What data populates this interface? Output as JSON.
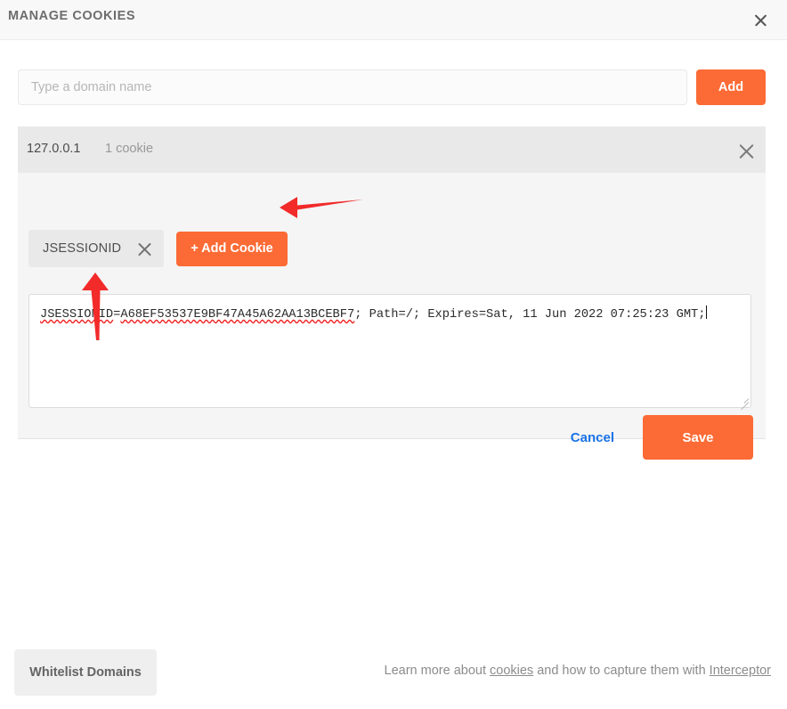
{
  "window": {
    "title": "MANAGE COOKIES",
    "close_icon": "close-icon"
  },
  "domain_entry": {
    "placeholder": "Type a domain name",
    "value": "",
    "add_label": "Add"
  },
  "domain_card": {
    "name": "127.0.0.1",
    "cookie_count": "1 cookie",
    "close_icon": "close-icon",
    "cookie_tabs": [
      {
        "label": "JSESSIONID",
        "close_icon": "close-icon"
      }
    ],
    "add_cookie_label": "+ Add Cookie",
    "cookie_value_part1": "JSESSIONID",
    "cookie_value_part2": "=",
    "cookie_value_part3": "A68EF53537E9BF47A45A62AA13BCEBF7",
    "cookie_value_part4": "; Path=/; Expires=Sat, 11 Jun 2022 07:25:23 GMT;",
    "cookie_value_full": "JSESSIONID=A68EF53537E9BF47A45A62AA13BCEBF7; Path=/; Expires=Sat, 11 Jun 2022 07:25:23 GMT;",
    "cancel_label": "Cancel",
    "save_label": "Save"
  },
  "footer": {
    "whitelist_label": "Whitelist Domains",
    "note_prefix": "Learn more about ",
    "link_cookies": "cookies",
    "note_middle": " and how to capture them with ",
    "link_interceptor": "Interceptor"
  },
  "annotations": {
    "arrow_color": "#f22a2a",
    "arrow_left_name": "arrow-pointing-to-add-cookie",
    "arrow_up_name": "arrow-pointing-to-cookie-name"
  },
  "colors": {
    "accent_orange": "#fc6b35",
    "link_blue": "#1a73e8",
    "header_bg": "#f8f8f8",
    "card_bg": "#f5f5f5",
    "card_head_bg": "#e9e9e9"
  }
}
